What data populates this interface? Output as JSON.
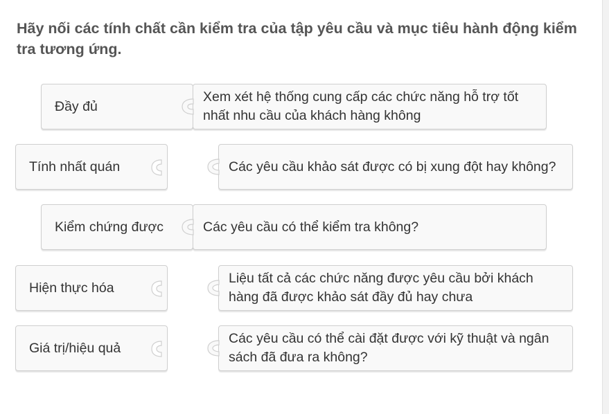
{
  "question": "Hãy nối các tính chất cần kiểm tra của tập yêu cầu và mục tiêu hành động kiểm tra tương ứng.",
  "pairs": [
    {
      "label": "Đầy đủ",
      "target": "Xem xét hệ thống cung cấp các chức năng hỗ trợ tốt nhất nhu cầu của khách hàng không",
      "matched": true
    },
    {
      "label": "Tính nhất quán",
      "target": "Các yêu cầu khảo sát được có bị xung đột hay không?",
      "matched": false
    },
    {
      "label": "Kiểm chứng được",
      "target": "Các yêu cầu có thể kiểm tra không?",
      "matched": true
    },
    {
      "label": "Hiện thực hóa",
      "target": "Liệu tất cả các chức năng được yêu cầu bởi khách hàng đã được khảo sát đầy đủ hay chưa",
      "matched": false
    },
    {
      "label": "Giá trị/hiệu quả",
      "target": "Các yêu cầu có thể cài đặt được với kỹ thuật và ngân sách đã đưa ra không?",
      "matched": false
    }
  ],
  "colors": {
    "piece_bg": "#f9f9f9",
    "piece_border": "#cfcfcf",
    "text": "#333333",
    "question_text": "#555555"
  }
}
